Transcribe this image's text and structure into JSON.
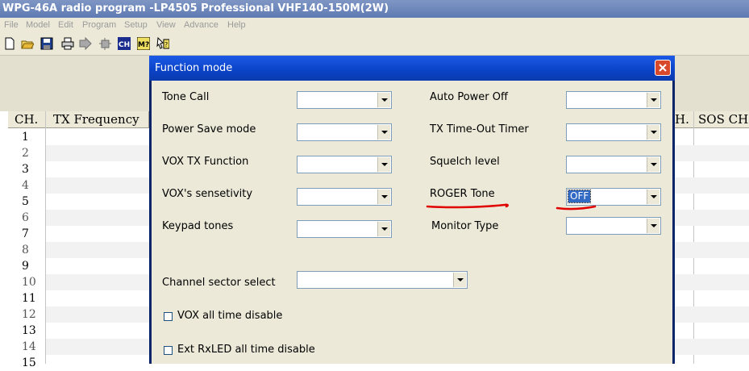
{
  "window": {
    "title": "WPG-46A radio program -LP4505 Professional VHF140-150M(2W)"
  },
  "menu": [
    "File",
    "Model",
    "Edit",
    "Program",
    "Setup",
    "View",
    "Advance",
    "Help"
  ],
  "toolbar": [
    "new-icon",
    "open-icon",
    "save-icon",
    "print-icon",
    "read-icon",
    "write-icon",
    "ch-icon",
    "help-icon",
    "context-help-icon"
  ],
  "grid": {
    "headers": {
      "ch": "CH.",
      "tx_frequency": "TX Frequency",
      "right_partial": "H.",
      "sos": "SOS CH"
    },
    "rows": [
      "1",
      "2",
      "3",
      "4",
      "5",
      "6",
      "7",
      "8",
      "9",
      "10",
      "11",
      "12",
      "13",
      "14",
      "15"
    ]
  },
  "dialog": {
    "title": "Function mode",
    "left_fields": [
      {
        "label": "Tone Call",
        "value": ""
      },
      {
        "label": "Power Save mode",
        "value": ""
      },
      {
        "label": "VOX TX Function",
        "value": ""
      },
      {
        "label": "VOX's sensetivity",
        "value": ""
      },
      {
        "label": "Keypad tones",
        "value": ""
      }
    ],
    "right_fields": [
      {
        "label": "Auto Power Off",
        "value": ""
      },
      {
        "label": "TX Time-Out Timer",
        "value": ""
      },
      {
        "label": "Squelch level",
        "value": ""
      },
      {
        "label": "ROGER Tone",
        "value": "OFF"
      },
      {
        "label": "Monitor Type",
        "value": ""
      }
    ],
    "channel_sector": {
      "label": "Channel sector select",
      "value": ""
    },
    "checkboxes": [
      {
        "label": "VOX all time disable",
        "checked": false
      },
      {
        "label": "Ext RxLED all time disable",
        "checked": false
      }
    ]
  },
  "colors": {
    "title_blue": "#0b44c9",
    "annotation_red": "#e00000",
    "selection_blue": "#316ac5"
  }
}
